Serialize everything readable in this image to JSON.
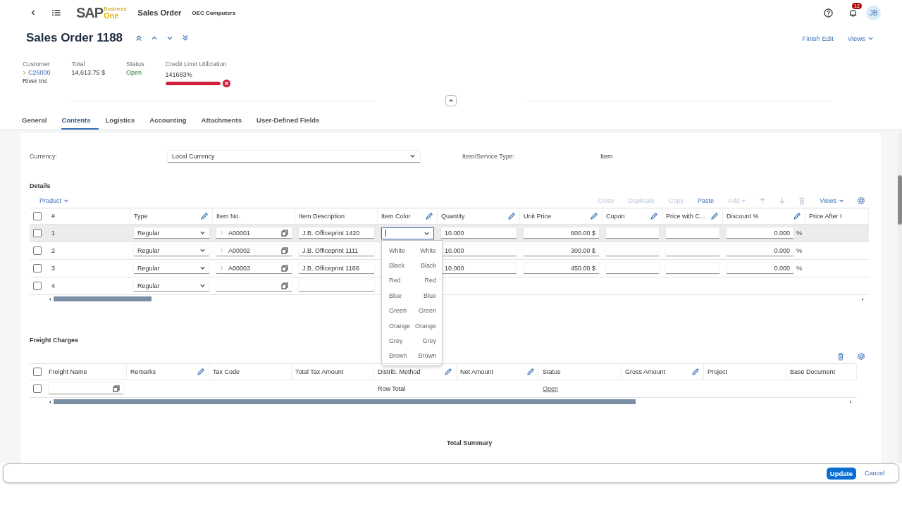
{
  "shell": {
    "logo_main": "SAP",
    "logo_top": "Business",
    "logo_bottom": "One",
    "app_title": "Sales Order",
    "company": "OEC Computers",
    "notification_count": "12",
    "avatar": "JB"
  },
  "header": {
    "title": "Sales Order 1188",
    "actions": [
      "Finish Edit",
      "Views"
    ]
  },
  "summary": {
    "customer_label": "Customer",
    "customer_code": "C26000",
    "customer_name": "River Inc",
    "total_label": "Total",
    "total": "14,613.75 $",
    "status_label": "Status",
    "status": "Open",
    "credit_label": "Credit Limit Utilization",
    "credit_value": "141683%",
    "credit_bar": {
      "level": 1
    },
    "credit_error": true
  },
  "tabs": [
    {
      "label": "General",
      "selected": false
    },
    {
      "label": "Contents",
      "selected": true
    },
    {
      "label": "Logistics",
      "selected": false
    },
    {
      "label": "Accounting",
      "selected": false
    },
    {
      "label": "Attachments",
      "selected": false
    },
    {
      "label": "User-Defined Fields",
      "selected": false
    }
  ],
  "currency": {
    "label": "Currency:",
    "value": "Local Currency",
    "type_label": "Item/Service Type:",
    "type_value": "Item"
  },
  "details": {
    "title": "Details",
    "product_menu": "Product",
    "select_all": {
      "checked": false
    },
    "actions": [
      {
        "label": "Close",
        "disabled": true
      },
      {
        "label": "Duplicate",
        "disabled": true
      },
      {
        "label": "Copy",
        "disabled": true
      },
      {
        "label": "Paste",
        "disabled": false
      },
      {
        "label": "Add",
        "disabled": true
      }
    ],
    "views": "Views",
    "columns": [
      {
        "label": "#",
        "editable": false
      },
      {
        "label": "Type",
        "editable": true
      },
      {
        "label": "Item No.",
        "editable": false
      },
      {
        "label": "Item Description",
        "editable": false
      },
      {
        "label": "Item Color",
        "editable": true
      },
      {
        "label": "Quantity",
        "editable": true
      },
      {
        "label": "Unit Price",
        "editable": true
      },
      {
        "label": "Cupon",
        "editable": true
      },
      {
        "label": "Price with C...",
        "editable": true
      },
      {
        "label": "Discount %",
        "editable": true
      },
      {
        "label": "Price After I",
        "editable": false
      }
    ],
    "rows": [
      {
        "num": "1",
        "type": "Regular",
        "item_no": "A00001",
        "description": "J.B. Officeprint 1420",
        "quantity": "10.000",
        "unit_price": "600.00 $",
        "discount": "0.000",
        "percent": "%",
        "selected": true,
        "checked": false
      },
      {
        "num": "2",
        "type": "Regular",
        "item_no": "A00002",
        "description": "J.B. Officeprint 1111",
        "quantity": "10.000",
        "unit_price": "300.00 $",
        "discount": "0.000",
        "percent": "%",
        "selected": false,
        "checked": false
      },
      {
        "num": "3",
        "type": "Regular",
        "item_no": "A00003",
        "description": "J.B. Officeprint 1186",
        "quantity": "10.000",
        "unit_price": "450.00 $",
        "discount": "0.000",
        "percent": "%",
        "selected": false,
        "checked": false
      },
      {
        "num": "4",
        "type": "Regular",
        "selected": false,
        "checked": false
      }
    ],
    "color_options": [
      {
        "name": "White",
        "code": "White"
      },
      {
        "name": "Black",
        "code": "Black"
      },
      {
        "name": "Red",
        "code": "Red"
      },
      {
        "name": "Blue",
        "code": "Blue"
      },
      {
        "name": "Green",
        "code": "Green"
      },
      {
        "name": "Orange",
        "code": "Orange"
      },
      {
        "name": "Grey",
        "code": "Grey"
      },
      {
        "name": "Brown",
        "code": "Brown"
      }
    ]
  },
  "freight": {
    "title": "Freight Charges",
    "select_all": {
      "checked": false
    },
    "columns": [
      {
        "label": "Freight Name",
        "editable": false
      },
      {
        "label": "Remarks",
        "editable": true
      },
      {
        "label": "Tax Code",
        "editable": false
      },
      {
        "label": "Total Tax Amount",
        "editable": false
      },
      {
        "label": "Distrib. Method",
        "editable": true
      },
      {
        "label": "Net Amount",
        "editable": true
      },
      {
        "label": "Status",
        "editable": false
      },
      {
        "label": "Gross Amount",
        "editable": true
      },
      {
        "label": "Project",
        "editable": false
      },
      {
        "label": "Base Document",
        "editable": false
      }
    ],
    "row": {
      "distrib": "Row Total",
      "status": "Open",
      "checked": false
    }
  },
  "total_summary": "Total Summary",
  "footer": {
    "primary": "Update",
    "secondary": "Cancel"
  }
}
